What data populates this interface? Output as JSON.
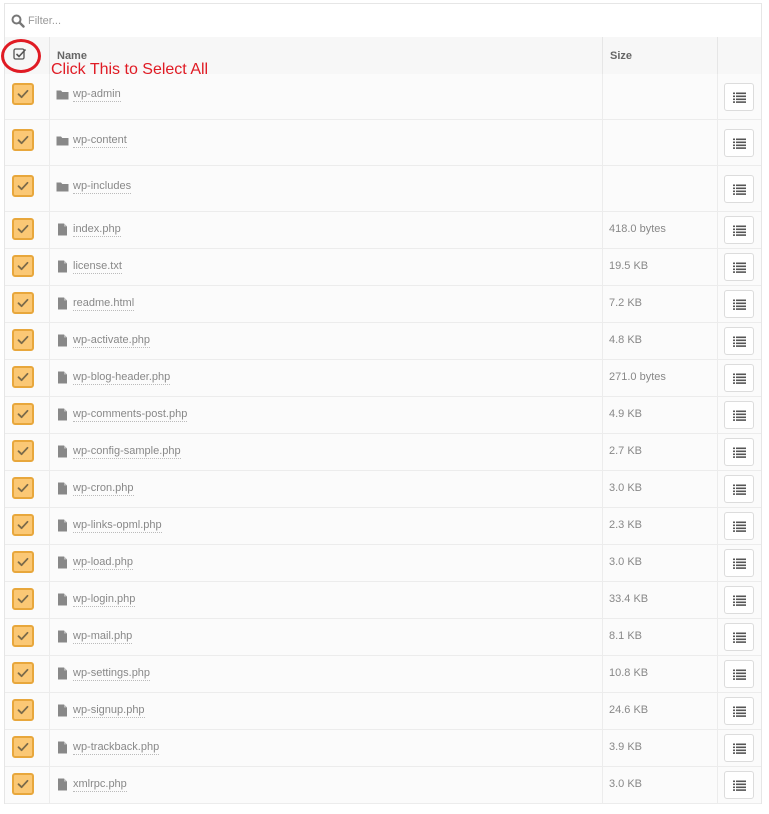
{
  "filter": {
    "placeholder": "Filter...",
    "icon": "search-icon"
  },
  "table": {
    "columns": {
      "name": "Name",
      "size": "Size"
    }
  },
  "annotation": {
    "text": "Click This to Select All",
    "color": "#e01b24"
  },
  "colors": {
    "checkbox_fill": "#fbc875",
    "checkbox_border": "#e8a73c",
    "check_mark": "#7a6a4a"
  },
  "files": [
    {
      "type": "folder",
      "name": "wp-admin",
      "size": ""
    },
    {
      "type": "folder",
      "name": "wp-content",
      "size": ""
    },
    {
      "type": "folder",
      "name": "wp-includes",
      "size": ""
    },
    {
      "type": "file",
      "name": "index.php",
      "size": "418.0 bytes"
    },
    {
      "type": "file",
      "name": "license.txt",
      "size": "19.5 KB"
    },
    {
      "type": "file",
      "name": "readme.html",
      "size": "7.2 KB"
    },
    {
      "type": "file",
      "name": "wp-activate.php",
      "size": "4.8 KB"
    },
    {
      "type": "file",
      "name": "wp-blog-header.php",
      "size": "271.0 bytes"
    },
    {
      "type": "file",
      "name": "wp-comments-post.php",
      "size": "4.9 KB"
    },
    {
      "type": "file",
      "name": "wp-config-sample.php",
      "size": "2.7 KB"
    },
    {
      "type": "file",
      "name": "wp-cron.php",
      "size": "3.0 KB"
    },
    {
      "type": "file",
      "name": "wp-links-opml.php",
      "size": "2.3 KB"
    },
    {
      "type": "file",
      "name": "wp-load.php",
      "size": "3.0 KB"
    },
    {
      "type": "file",
      "name": "wp-login.php",
      "size": "33.4 KB"
    },
    {
      "type": "file",
      "name": "wp-mail.php",
      "size": "8.1 KB"
    },
    {
      "type": "file",
      "name": "wp-settings.php",
      "size": "10.8 KB"
    },
    {
      "type": "file",
      "name": "wp-signup.php",
      "size": "24.6 KB"
    },
    {
      "type": "file",
      "name": "wp-trackback.php",
      "size": "3.9 KB"
    },
    {
      "type": "file",
      "name": "xmlrpc.php",
      "size": "3.0 KB"
    }
  ]
}
